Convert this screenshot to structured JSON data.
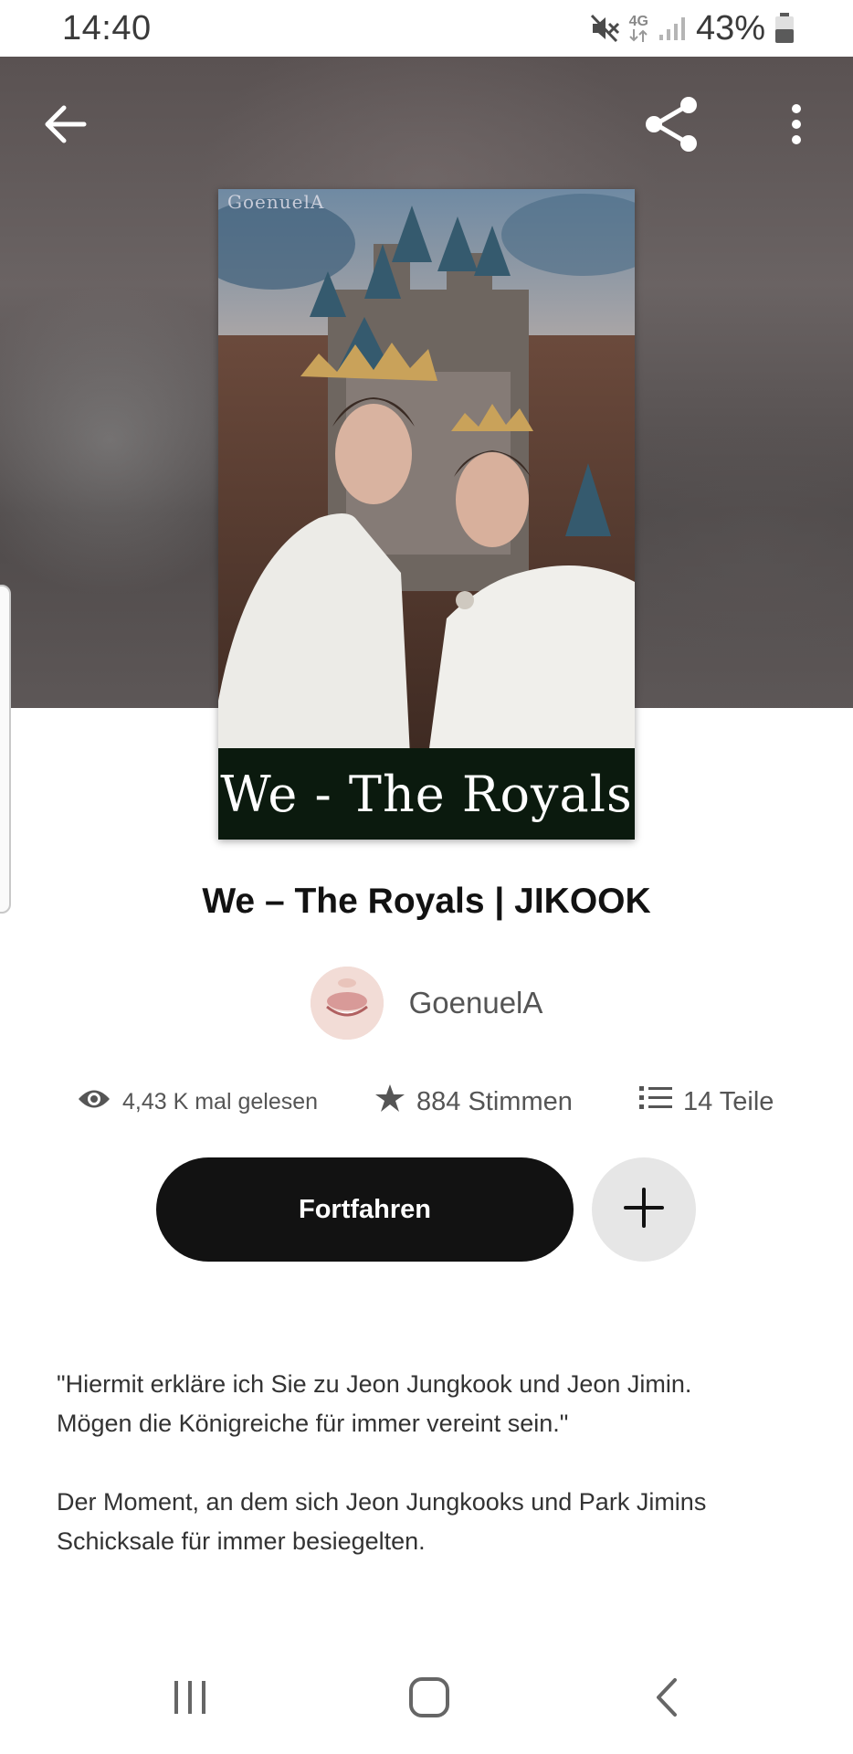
{
  "status_bar": {
    "time": "14:40",
    "network": "4G",
    "battery": "43%",
    "icons": [
      "mute-icon",
      "network-4g-icon",
      "signal-icon",
      "battery-icon"
    ]
  },
  "header": {
    "back_icon": "arrow-left-icon",
    "share_icon": "share-icon",
    "more_icon": "more-vertical-icon"
  },
  "cover": {
    "watermark": "GoenuelA",
    "title": "We - The Royals"
  },
  "story": {
    "title": "We – The Royals | JIKOOK",
    "author": "GoenuelA"
  },
  "stats": {
    "reads": "4,43 K mal gelesen",
    "votes": "884 Stimmen",
    "parts": "14 Teile"
  },
  "actions": {
    "continue_label": "Fortfahren",
    "add_icon": "plus-icon"
  },
  "description": {
    "paragraph_1_line_1": "\"Hiermit erkläre ich Sie zu Jeon Jungkook und Jeon Jimin.",
    "paragraph_1_line_2": "Mögen die Königreiche für immer vereint sein.\"",
    "paragraph_2_line_1": "Der Moment, an dem sich Jeon Jungkooks und Park Jimins",
    "paragraph_2_line_2": "Schicksale für immer besiegelten."
  },
  "nav_bar": {
    "icons": [
      "recent-apps-icon",
      "home-icon",
      "back-icon"
    ]
  }
}
